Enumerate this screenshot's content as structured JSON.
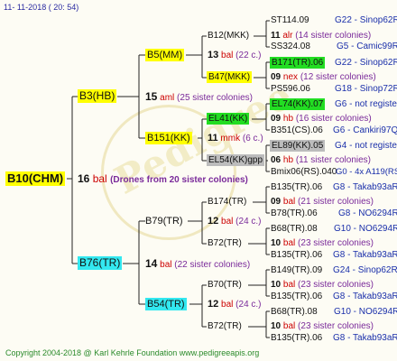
{
  "timestamp": "11-  11-2018 (  20:  54)",
  "copyright": "Copyright 2004-2018 @ Karl Kehrle Foundation     www.pedigreeapis.org",
  "root": {
    "label": "B10(CHM)",
    "gen": "16",
    "race": "bal",
    "note": "(Drones from 20 sister colonies)"
  },
  "branches": [
    {
      "label": "B3(HB)",
      "gen": "15",
      "race": "aml",
      "note": "(25 sister colonies)"
    },
    {
      "label": "B76(TR)",
      "gen": "14",
      "race": "bal",
      "note": "(22 sister colonies)"
    }
  ],
  "sub": [
    {
      "label": "B5(MM)",
      "gen": "13",
      "race": "bal",
      "note": "(22 c.)"
    },
    {
      "label": "B151(KK)",
      "gen": "11",
      "race": "mmk",
      "note": "(6 c.)"
    },
    {
      "label": "B79(TR)",
      "gen": "12",
      "race": "bal",
      "note": "(24 c.)"
    },
    {
      "label": "B54(TR)",
      "gen": "12",
      "race": "bal",
      "note": "(24 c.)"
    }
  ],
  "lvl3": [
    {
      "label": "B12(MKK)"
    },
    {
      "label": "B47(MKK)"
    },
    {
      "label": "EL41(KK)"
    },
    {
      "label": "EL54(KK)gpp"
    },
    {
      "label": "B174(TR)"
    },
    {
      "label": "B72(TR)"
    },
    {
      "label": "B70(TR)"
    },
    {
      "label": "B72(TR)"
    }
  ],
  "lvl3_info": [
    {
      "gen": "11",
      "race": "alr",
      "note": "(14 sister colonies)"
    },
    {
      "gen": "09",
      "race": "nex",
      "note": "(12 sister colonies)"
    },
    {
      "gen": "09",
      "race": "hb",
      "note": "(16 sister colonies)"
    },
    {
      "gen": "06",
      "race": "hb",
      "note": "(11 sister colonies)"
    },
    {
      "gen": "09",
      "race": "bal",
      "note": "(21 sister colonies)"
    },
    {
      "gen": "10",
      "race": "bal",
      "note": "(23 sister colonies)"
    },
    {
      "gen": "10",
      "race": "bal",
      "note": "(23 sister colonies)"
    },
    {
      "gen": "10",
      "race": "bal",
      "note": "(23 sister colonies)"
    }
  ],
  "leaves": [
    {
      "name": "ST114.09",
      "desc": "G22 - Sinop62R"
    },
    {
      "name": "SS324.08",
      "desc": "G5 - Camic99R"
    },
    {
      "name": "B171(TR).06",
      "desc": "G22 - Sinop62R"
    },
    {
      "name": "PS596.06",
      "desc": "G18 - Sinop72R"
    },
    {
      "name": "EL74(KK).07",
      "desc": "G6 - not registe"
    },
    {
      "name": "B351(CS).06",
      "desc": "G6 - Cankiri97Q"
    },
    {
      "name": "EL89(KK).05",
      "desc": "G4 - not registe"
    },
    {
      "name": "Bmix06(RS).040",
      "desc": "G0 - 4x A119(RS)"
    },
    {
      "name": "B135(TR).06",
      "desc": "G8 - Takab93aR"
    },
    {
      "name": "B78(TR).06",
      "desc": "G8 - NO6294R"
    },
    {
      "name": "B68(TR).08",
      "desc": "G10 - NO6294R"
    },
    {
      "name": "B135(TR).06",
      "desc": "G8 - Takab93aR"
    },
    {
      "name": "B149(TR).09",
      "desc": "G24 - Sinop62R"
    },
    {
      "name": "B135(TR).06",
      "desc": "G8 - Takab93aR"
    },
    {
      "name": "B68(TR).08",
      "desc": "G10 - NO6294R"
    },
    {
      "name": "B135(TR).06",
      "desc": "G8 - Takab93aR"
    }
  ]
}
